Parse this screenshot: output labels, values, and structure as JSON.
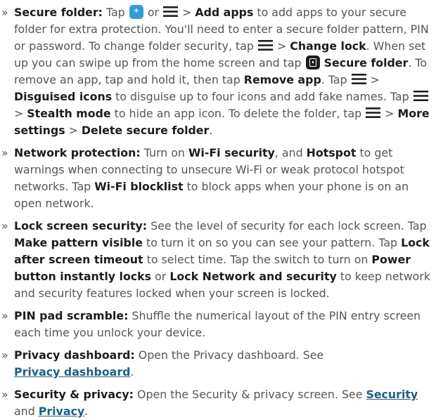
{
  "bullet": "»",
  "items": [
    {
      "title": "Secure folder:",
      "t1": "Tap",
      "t2": "or",
      "t3": ">",
      "add_apps": "Add apps",
      "t4": "to add apps to your secure folder for extra protection. You'll need to enter a secure folder pattern, PIN or password. To change folder security, tap",
      "t5": ">",
      "change_lock": "Change lock",
      "t6": ". When set up you can swipe up from the home screen and tap",
      "secure_folder": "Secure folder",
      "t7": ". To remove an app, tap and hold it, then tap",
      "remove_app": "Remove app",
      "t8": ". Tap",
      "t9": ">",
      "disguised_icons": "Disguised icons",
      "t10": "to disguise up to four icons and add fake names. Tap",
      "t11": ">",
      "stealth_mode": "Stealth mode",
      "t12": "to hide an app icon. To delete the folder, tap",
      "t13": ">",
      "more_settings": "More settings",
      "t14": ">",
      "delete_secure_folder": "Delete secure folder",
      "t15": "."
    },
    {
      "title": "Network protection:",
      "t1": "Turn on",
      "wifi_security": "Wi-Fi security",
      "t2": ", and",
      "hotspot": "Hotspot",
      "t3": "to get warnings when connecting to unsecure Wi-Fi or weak protocol hotspot networks. Tap",
      "wifi_blocklist": "Wi-Fi blocklist",
      "t4": "to block apps when your phone is on an open network."
    },
    {
      "title": "Lock screen security:",
      "t1": "See the level of security for each lock screen. Tap",
      "make_pattern_visible": "Make pattern visible",
      "t2": "to turn it on so you can see your pattern. Tap",
      "lock_after_timeout": "Lock after screen timeout",
      "t3": "to select time. Tap the switch to turn on",
      "power_button": "Power button instantly locks",
      "t4": "or",
      "lock_network": "Lock Network and security",
      "t5": "to keep network and security features locked when your screen is locked."
    },
    {
      "title": "PIN pad scramble:",
      "t1": "Shuffle the numerical layout of the PIN entry screen each time you unlock your device."
    },
    {
      "title": "Privacy dashboard:",
      "t1": "Open the Privacy dashboard. See",
      "link1": "Privacy dashboard",
      "t2": "."
    },
    {
      "title": "Security & privacy:",
      "t1": "Open the Security & privacy screen. See",
      "link1": "Security",
      "t2": "and",
      "link2": "Privacy",
      "t3": "."
    }
  ],
  "icons": {
    "plus": "add-app-icon",
    "menu": "menu-icon",
    "folder": "secure-folder-app-icon"
  },
  "colors": {
    "text": "#555555",
    "bold": "#1d1d1d",
    "link": "#1f5f86",
    "plus_icon_bg": "#2d9fd8",
    "folder_icon_bg": "#1e1e1e"
  }
}
